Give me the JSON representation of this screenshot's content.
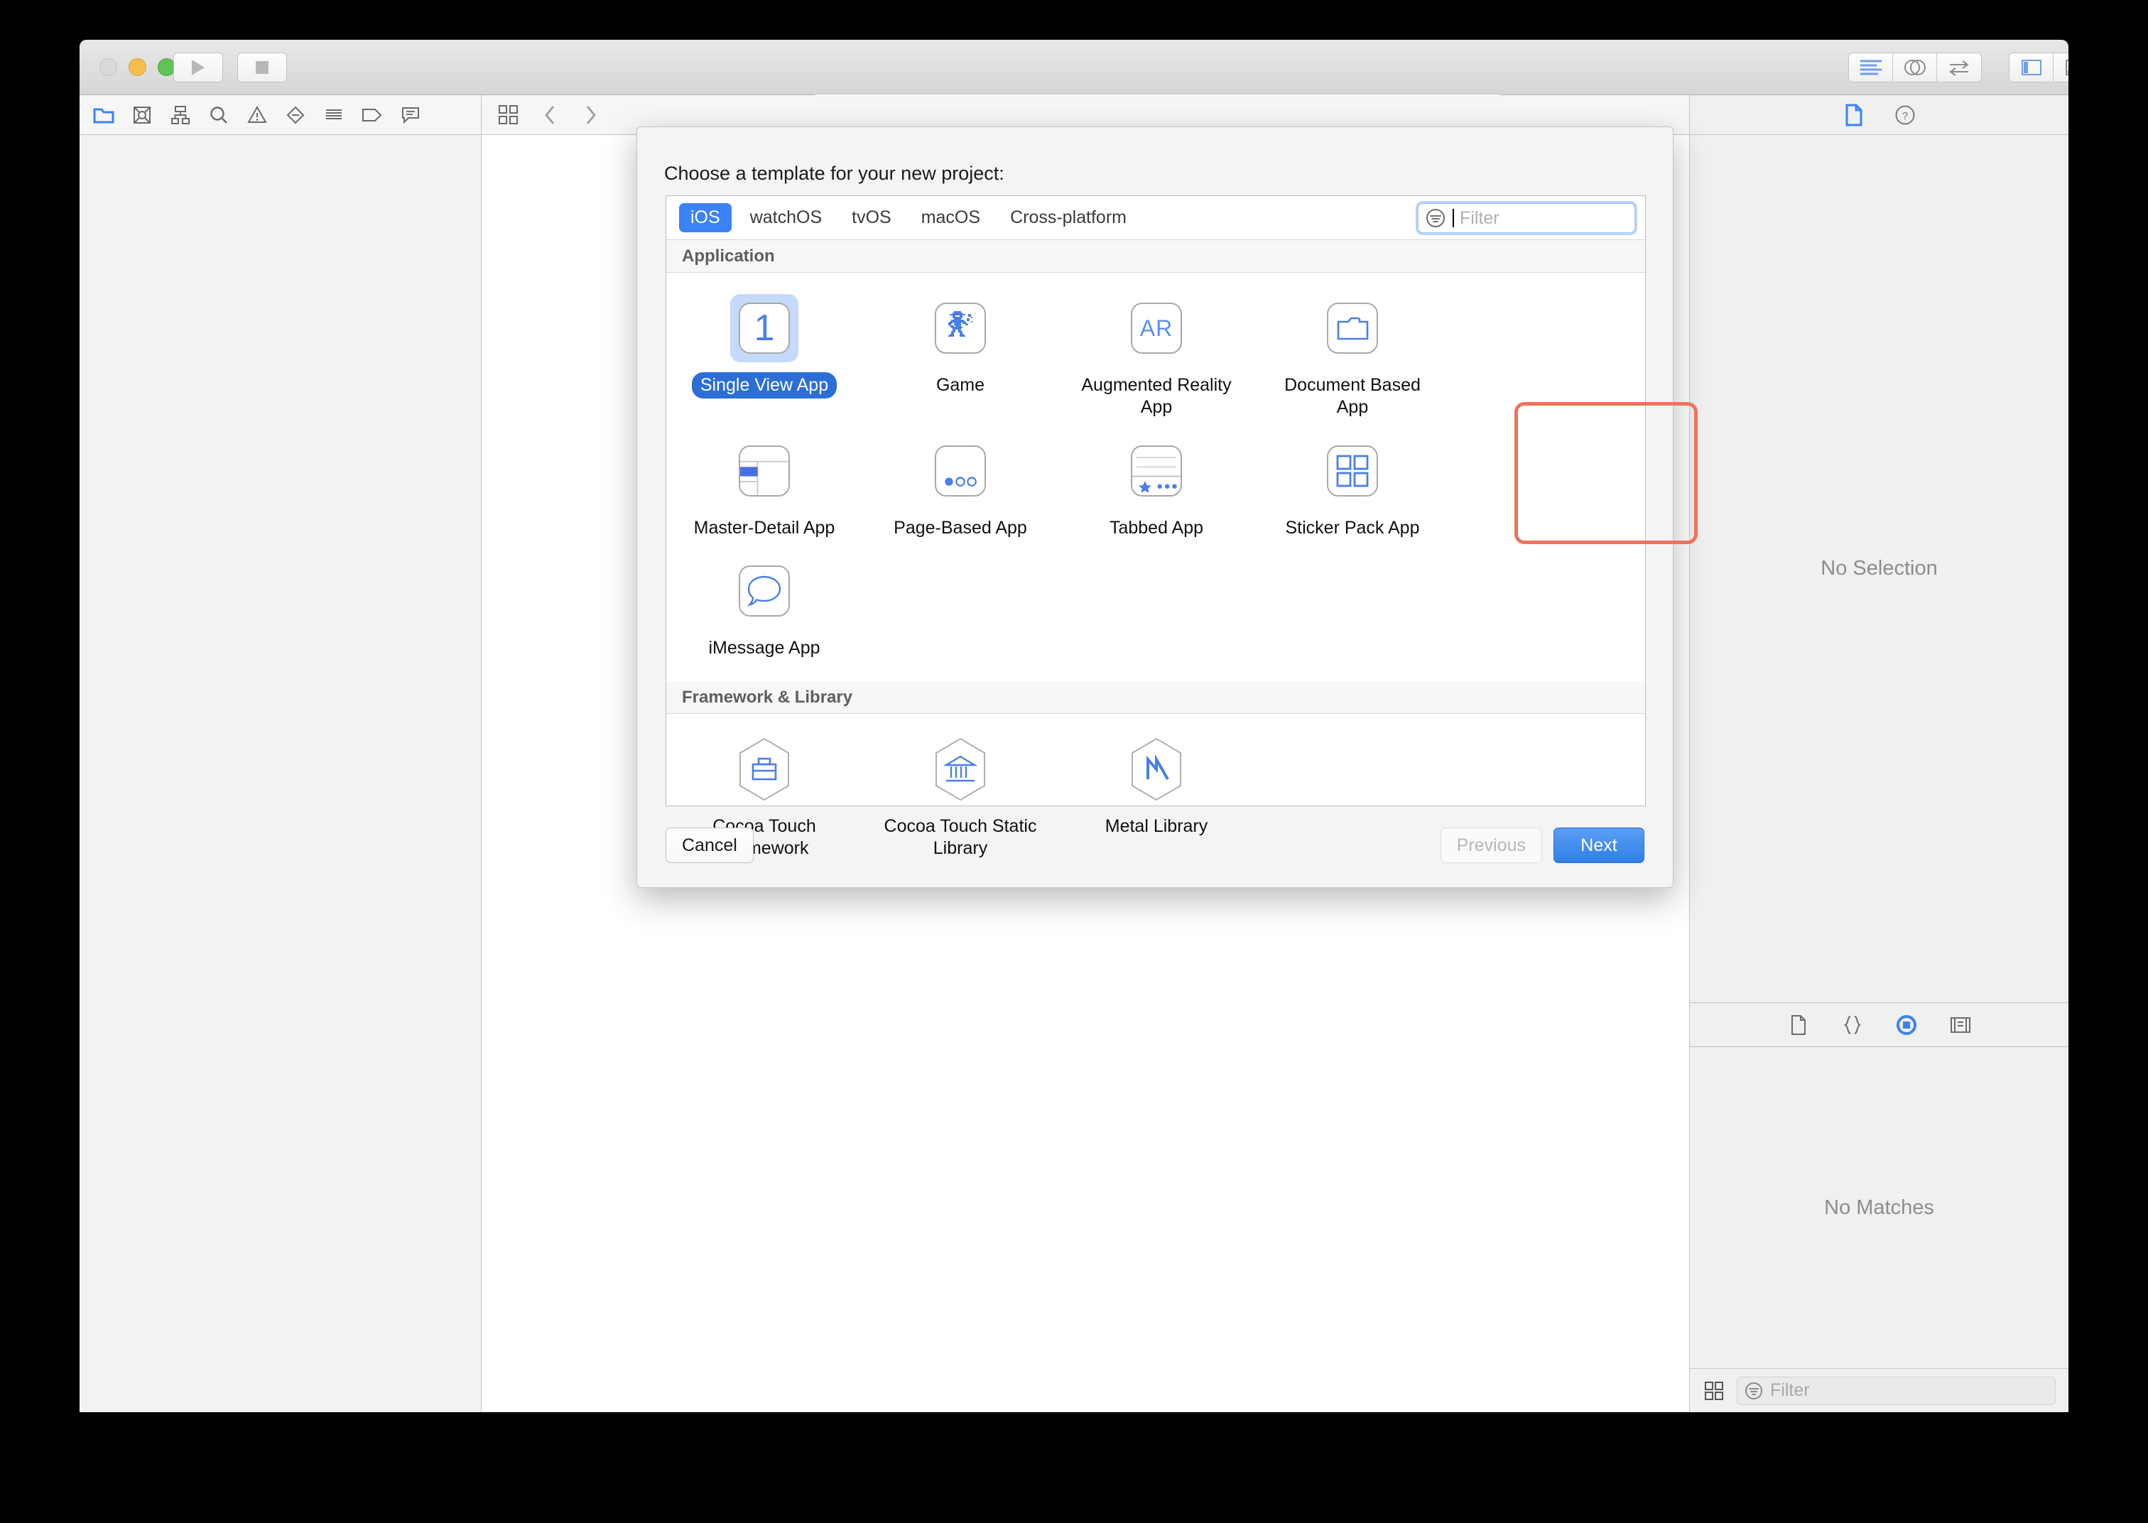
{
  "window": {
    "traffic_lights": [
      "close",
      "minimize",
      "zoom"
    ],
    "run_button": "run",
    "stop_button": "stop",
    "status_field_value": "",
    "editor_modes": [
      "standard-editor",
      "assistant-editor",
      "version-editor"
    ],
    "view_toggles": [
      "navigator-toggle",
      "debug-area-toggle",
      "inspector-toggle"
    ]
  },
  "navigator_toolbar": {
    "items": [
      {
        "icon": "folder-icon",
        "label": "Project navigator",
        "active": true
      },
      {
        "icon": "source-control-icon",
        "label": "Source control navigator",
        "active": false
      },
      {
        "icon": "symbol-hierarchy-icon",
        "label": "Symbol navigator",
        "active": false
      },
      {
        "icon": "search-icon",
        "label": "Find navigator",
        "active": false
      },
      {
        "icon": "warning-triangle-icon",
        "label": "Issue navigator",
        "active": false
      },
      {
        "icon": "test-diamond-icon",
        "label": "Test navigator",
        "active": false
      },
      {
        "icon": "report-lines-icon",
        "label": "Report navigator",
        "active": false
      },
      {
        "icon": "tag-icon",
        "label": "Debug navigator",
        "active": false
      },
      {
        "icon": "comment-bubble-icon",
        "label": "Breakpoint navigator",
        "active": false
      }
    ]
  },
  "editor_toolbar": {
    "items": [
      {
        "icon": "related-items-grid-icon",
        "label": "Related items"
      },
      {
        "icon": "chevron-left-icon",
        "label": "Go back"
      },
      {
        "icon": "chevron-right-icon",
        "label": "Go forward"
      }
    ]
  },
  "inspector": {
    "tabs": [
      {
        "icon": "file-inspector-icon",
        "label": "File inspector",
        "active": true
      },
      {
        "icon": "quick-help-icon",
        "label": "Quick Help inspector",
        "active": false
      }
    ],
    "no_selection_text": "No Selection",
    "library_tabs": [
      {
        "icon": "file-template-library-icon",
        "label": "File template library",
        "active": false
      },
      {
        "icon": "code-snippet-library-icon",
        "label": "Code snippet library",
        "active": false
      },
      {
        "icon": "object-library-icon",
        "label": "Object library",
        "active": true
      },
      {
        "icon": "media-library-icon",
        "label": "Media library",
        "active": false
      }
    ],
    "no_matches_text": "No Matches",
    "library_filter_placeholder": "Filter",
    "library_filter_value": "",
    "library_grid_icon": "grid-view-icon"
  },
  "sheet": {
    "title": "Choose a template for your new project:",
    "platforms": [
      {
        "label": "iOS",
        "active": true
      },
      {
        "label": "watchOS",
        "active": false
      },
      {
        "label": "tvOS",
        "active": false
      },
      {
        "label": "macOS",
        "active": false
      },
      {
        "label": "Cross-platform",
        "active": false
      }
    ],
    "filter": {
      "placeholder": "Filter",
      "value": "",
      "icon": "filter-circle-icon",
      "focused": true
    },
    "sections": [
      {
        "header": "Application",
        "templates": [
          {
            "label": "Single View App",
            "icon": "number-one-icon",
            "selected": true
          },
          {
            "label": "Game",
            "icon": "robot-pixel-icon",
            "selected": false
          },
          {
            "label": "Augmented Reality App",
            "icon": "ar-text-icon",
            "selected": false
          },
          {
            "label": "Document Based App",
            "icon": "folder-outline-icon",
            "selected": false
          },
          {
            "label": "Master-Detail App",
            "icon": "split-view-icon",
            "selected": false,
            "highlighted": true
          },
          {
            "label": "Page-Based App",
            "icon": "page-dots-icon",
            "selected": false
          },
          {
            "label": "Tabbed App",
            "icon": "tab-bar-icon",
            "selected": false
          },
          {
            "label": "Sticker Pack App",
            "icon": "four-squares-icon",
            "selected": false
          },
          {
            "label": "iMessage App",
            "icon": "speech-bubble-icon",
            "selected": false
          }
        ]
      },
      {
        "header": "Framework & Library",
        "templates": [
          {
            "label": "Cocoa Touch Framework",
            "icon": "briefcase-hexagon-icon",
            "selected": false
          },
          {
            "label": "Cocoa Touch Static Library",
            "icon": "bank-hexagon-icon",
            "selected": false
          },
          {
            "label": "Metal Library",
            "icon": "metal-m-hexagon-icon",
            "selected": false
          }
        ]
      }
    ],
    "buttons": {
      "cancel": "Cancel",
      "previous": "Previous",
      "previous_disabled": true,
      "next": "Next"
    }
  },
  "colors": {
    "accent_blue": "#3b82f6",
    "selected_pill": "#2c6ed5",
    "selected_icon_bg": "#c5dafa",
    "highlight_red": "#f2715c",
    "icon_blue": "#4a7fe8",
    "muted_text": "#8d8d8d"
  }
}
